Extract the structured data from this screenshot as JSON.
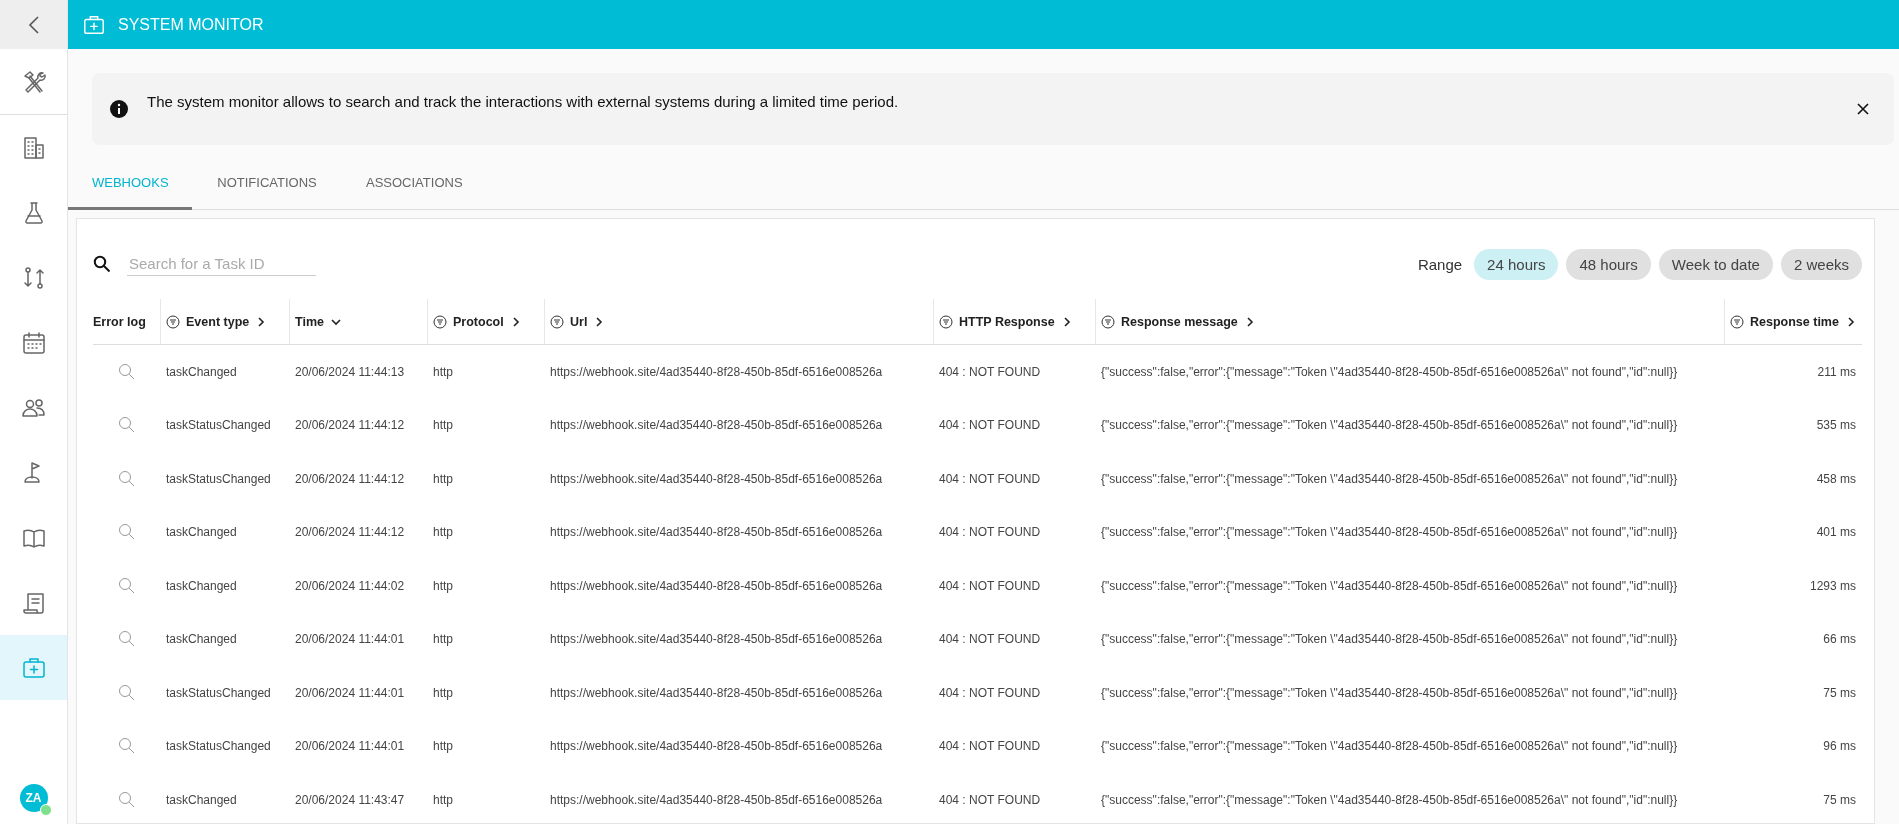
{
  "header": {
    "title": "SYSTEM MONITOR"
  },
  "sidebar": {
    "items": [
      {
        "selected": false
      },
      {
        "selected": false
      },
      {
        "selected": false
      },
      {
        "selected": false
      },
      {
        "selected": false
      },
      {
        "selected": false
      },
      {
        "selected": false
      },
      {
        "selected": false
      },
      {
        "selected": false
      },
      {
        "selected": true
      }
    ],
    "avatar": {
      "initials": "ZA",
      "online": true
    }
  },
  "banner": {
    "text": "The system monitor allows to search and track the interactions with external systems during a limited time period."
  },
  "tabs": [
    {
      "label": "WEBHOOKS",
      "selected": true
    },
    {
      "label": "NOTIFICATIONS",
      "selected": false
    },
    {
      "label": "ASSOCIATIONS",
      "selected": false
    }
  ],
  "search": {
    "placeholder": "Search for a Task ID"
  },
  "range": {
    "label": "Range",
    "options": [
      {
        "label": "24 hours",
        "selected": true
      },
      {
        "label": "48 hours",
        "selected": false
      },
      {
        "label": "Week to date",
        "selected": false
      },
      {
        "label": "2 weeks",
        "selected": false
      }
    ]
  },
  "table": {
    "columns": [
      {
        "label": "Error log",
        "filterable": false,
        "sortable": false,
        "sorted": false
      },
      {
        "label": "Event type",
        "filterable": true,
        "sortable": true,
        "sorted": false
      },
      {
        "label": "Time",
        "filterable": false,
        "sortable": true,
        "sorted": true
      },
      {
        "label": "Protocol",
        "filterable": true,
        "sortable": true,
        "sorted": false
      },
      {
        "label": "Url",
        "filterable": true,
        "sortable": true,
        "sorted": false
      },
      {
        "label": "HTTP Response",
        "filterable": true,
        "sortable": true,
        "sorted": false
      },
      {
        "label": "Response message",
        "filterable": true,
        "sortable": true,
        "sorted": false
      },
      {
        "label": "Response time",
        "filterable": true,
        "sortable": true,
        "sorted": false
      }
    ],
    "rows": [
      {
        "event_type": "taskChanged",
        "time": "20/06/2024 11:44:13",
        "protocol": "http",
        "url": "https://webhook.site/4ad35440-8f28-450b-85df-6516e008526a",
        "http_response": "404 : NOT FOUND",
        "response_message": "{\"success\":false,\"error\":{\"message\":\"Token \\\"4ad35440-8f28-450b-85df-6516e008526a\\\" not found\",\"id\":null}}",
        "response_time": "211 ms"
      },
      {
        "event_type": "taskStatusChanged",
        "time": "20/06/2024 11:44:12",
        "protocol": "http",
        "url": "https://webhook.site/4ad35440-8f28-450b-85df-6516e008526a",
        "http_response": "404 : NOT FOUND",
        "response_message": "{\"success\":false,\"error\":{\"message\":\"Token \\\"4ad35440-8f28-450b-85df-6516e008526a\\\" not found\",\"id\":null}}",
        "response_time": "535 ms"
      },
      {
        "event_type": "taskStatusChanged",
        "time": "20/06/2024 11:44:12",
        "protocol": "http",
        "url": "https://webhook.site/4ad35440-8f28-450b-85df-6516e008526a",
        "http_response": "404 : NOT FOUND",
        "response_message": "{\"success\":false,\"error\":{\"message\":\"Token \\\"4ad35440-8f28-450b-85df-6516e008526a\\\" not found\",\"id\":null}}",
        "response_time": "458 ms"
      },
      {
        "event_type": "taskChanged",
        "time": "20/06/2024 11:44:12",
        "protocol": "http",
        "url": "https://webhook.site/4ad35440-8f28-450b-85df-6516e008526a",
        "http_response": "404 : NOT FOUND",
        "response_message": "{\"success\":false,\"error\":{\"message\":\"Token \\\"4ad35440-8f28-450b-85df-6516e008526a\\\" not found\",\"id\":null}}",
        "response_time": "401 ms"
      },
      {
        "event_type": "taskChanged",
        "time": "20/06/2024 11:44:02",
        "protocol": "http",
        "url": "https://webhook.site/4ad35440-8f28-450b-85df-6516e008526a",
        "http_response": "404 : NOT FOUND",
        "response_message": "{\"success\":false,\"error\":{\"message\":\"Token \\\"4ad35440-8f28-450b-85df-6516e008526a\\\" not found\",\"id\":null}}",
        "response_time": "1293 ms"
      },
      {
        "event_type": "taskChanged",
        "time": "20/06/2024 11:44:01",
        "protocol": "http",
        "url": "https://webhook.site/4ad35440-8f28-450b-85df-6516e008526a",
        "http_response": "404 : NOT FOUND",
        "response_message": "{\"success\":false,\"error\":{\"message\":\"Token \\\"4ad35440-8f28-450b-85df-6516e008526a\\\" not found\",\"id\":null}}",
        "response_time": "66 ms"
      },
      {
        "event_type": "taskStatusChanged",
        "time": "20/06/2024 11:44:01",
        "protocol": "http",
        "url": "https://webhook.site/4ad35440-8f28-450b-85df-6516e008526a",
        "http_response": "404 : NOT FOUND",
        "response_message": "{\"success\":false,\"error\":{\"message\":\"Token \\\"4ad35440-8f28-450b-85df-6516e008526a\\\" not found\",\"id\":null}}",
        "response_time": "75 ms"
      },
      {
        "event_type": "taskStatusChanged",
        "time": "20/06/2024 11:44:01",
        "protocol": "http",
        "url": "https://webhook.site/4ad35440-8f28-450b-85df-6516e008526a",
        "http_response": "404 : NOT FOUND",
        "response_message": "{\"success\":false,\"error\":{\"message\":\"Token \\\"4ad35440-8f28-450b-85df-6516e008526a\\\" not found\",\"id\":null}}",
        "response_time": "96 ms"
      },
      {
        "event_type": "taskChanged",
        "time": "20/06/2024 11:43:47",
        "protocol": "http",
        "url": "https://webhook.site/4ad35440-8f28-450b-85df-6516e008526a",
        "http_response": "404 : NOT FOUND",
        "response_message": "{\"success\":false,\"error\":{\"message\":\"Token \\\"4ad35440-8f28-450b-85df-6516e008526a\\\" not found\",\"id\":null}}",
        "response_time": "75 ms"
      }
    ]
  }
}
